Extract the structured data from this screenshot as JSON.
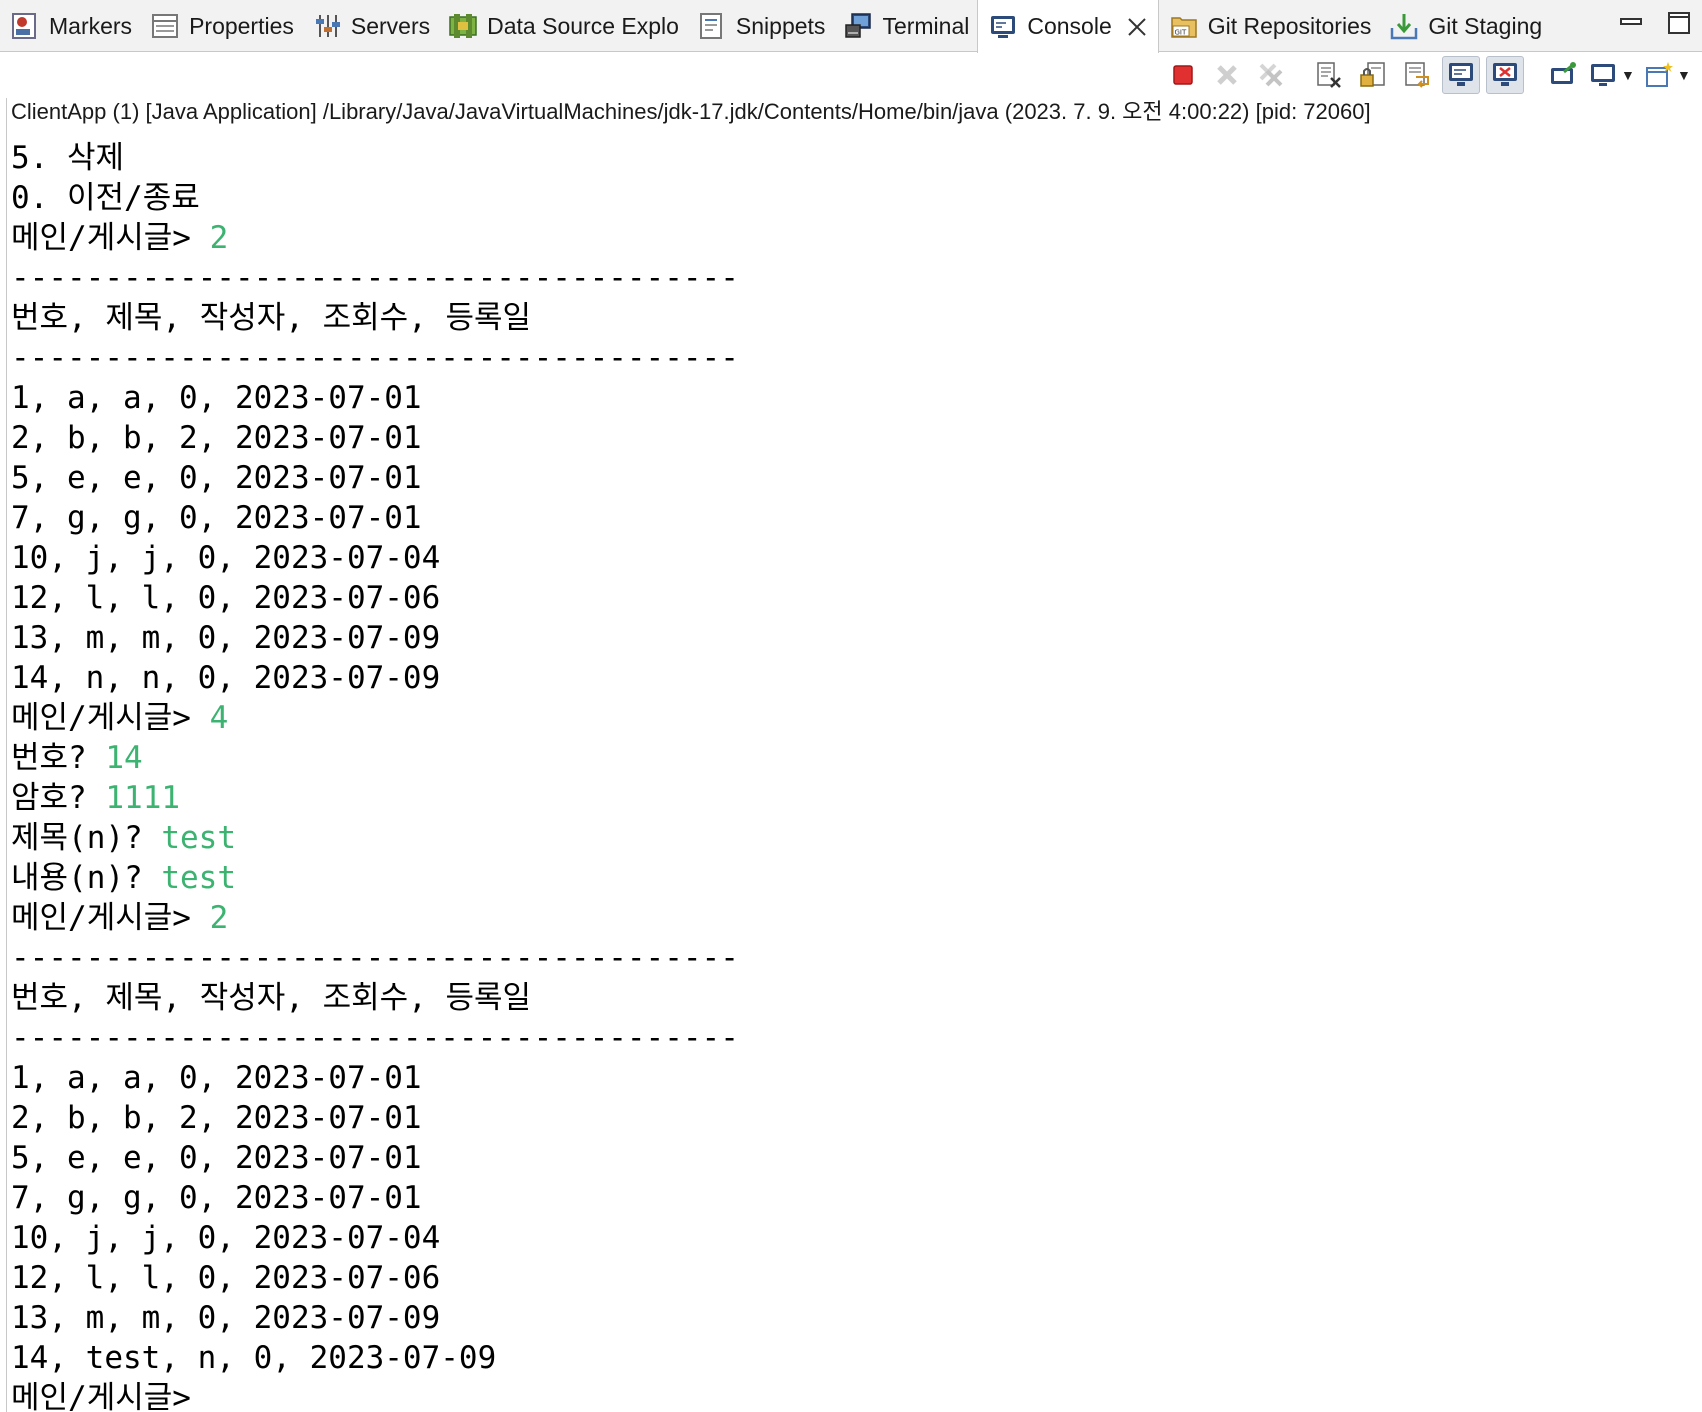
{
  "tabs": [
    {
      "label": "Markers",
      "icon": "markers-icon"
    },
    {
      "label": "Properties",
      "icon": "properties-icon"
    },
    {
      "label": "Servers",
      "icon": "servers-icon"
    },
    {
      "label": "Data Source Explo",
      "icon": "data-source-icon"
    },
    {
      "label": "Snippets",
      "icon": "snippets-icon"
    },
    {
      "label": "Terminal",
      "icon": "terminal-icon"
    },
    {
      "label": "Console",
      "icon": "console-icon",
      "active": true
    },
    {
      "label": "Git Repositories",
      "icon": "git-repositories-icon"
    },
    {
      "label": "Git Staging",
      "icon": "git-staging-icon"
    }
  ],
  "process_info": "ClientApp (1) [Java Application] /Library/Java/JavaVirtualMachines/jdk-17.jdk/Contents/Home/bin/java  (2023. 7. 9. 오전 4:00:22) [pid: 72060]",
  "colors": {
    "input_text": "#3cb371",
    "terminate_red": "#e03030"
  },
  "console_lines": [
    {
      "text": "5. 삭제"
    },
    {
      "text": "0. 이전/종료"
    },
    {
      "text": "메인/게시글> ",
      "input": "2"
    },
    {
      "text": "---------------------------------------"
    },
    {
      "text": "번호, 제목, 작성자, 조회수, 등록일"
    },
    {
      "text": "---------------------------------------"
    },
    {
      "text": "1, a, a, 0, 2023-07-01"
    },
    {
      "text": "2, b, b, 2, 2023-07-01"
    },
    {
      "text": "5, e, e, 0, 2023-07-01"
    },
    {
      "text": "7, g, g, 0, 2023-07-01"
    },
    {
      "text": "10, j, j, 0, 2023-07-04"
    },
    {
      "text": "12, l, l, 0, 2023-07-06"
    },
    {
      "text": "13, m, m, 0, 2023-07-09"
    },
    {
      "text": "14, n, n, 0, 2023-07-09"
    },
    {
      "text": "메인/게시글> ",
      "input": "4"
    },
    {
      "text": "번호? ",
      "input": "14"
    },
    {
      "text": "암호? ",
      "input": "1111"
    },
    {
      "text": "제목(n)? ",
      "input": "test"
    },
    {
      "text": "내용(n)? ",
      "input": "test"
    },
    {
      "text": "메인/게시글> ",
      "input": "2"
    },
    {
      "text": "---------------------------------------"
    },
    {
      "text": "번호, 제목, 작성자, 조회수, 등록일"
    },
    {
      "text": "---------------------------------------"
    },
    {
      "text": "1, a, a, 0, 2023-07-01"
    },
    {
      "text": "2, b, b, 2, 2023-07-01"
    },
    {
      "text": "5, e, e, 0, 2023-07-01"
    },
    {
      "text": "7, g, g, 0, 2023-07-01"
    },
    {
      "text": "10, j, j, 0, 2023-07-04"
    },
    {
      "text": "12, l, l, 0, 2023-07-06"
    },
    {
      "text": "13, m, m, 0, 2023-07-09"
    },
    {
      "text": "14, test, n, 0, 2023-07-09"
    },
    {
      "text": "메인/게시글>"
    }
  ]
}
